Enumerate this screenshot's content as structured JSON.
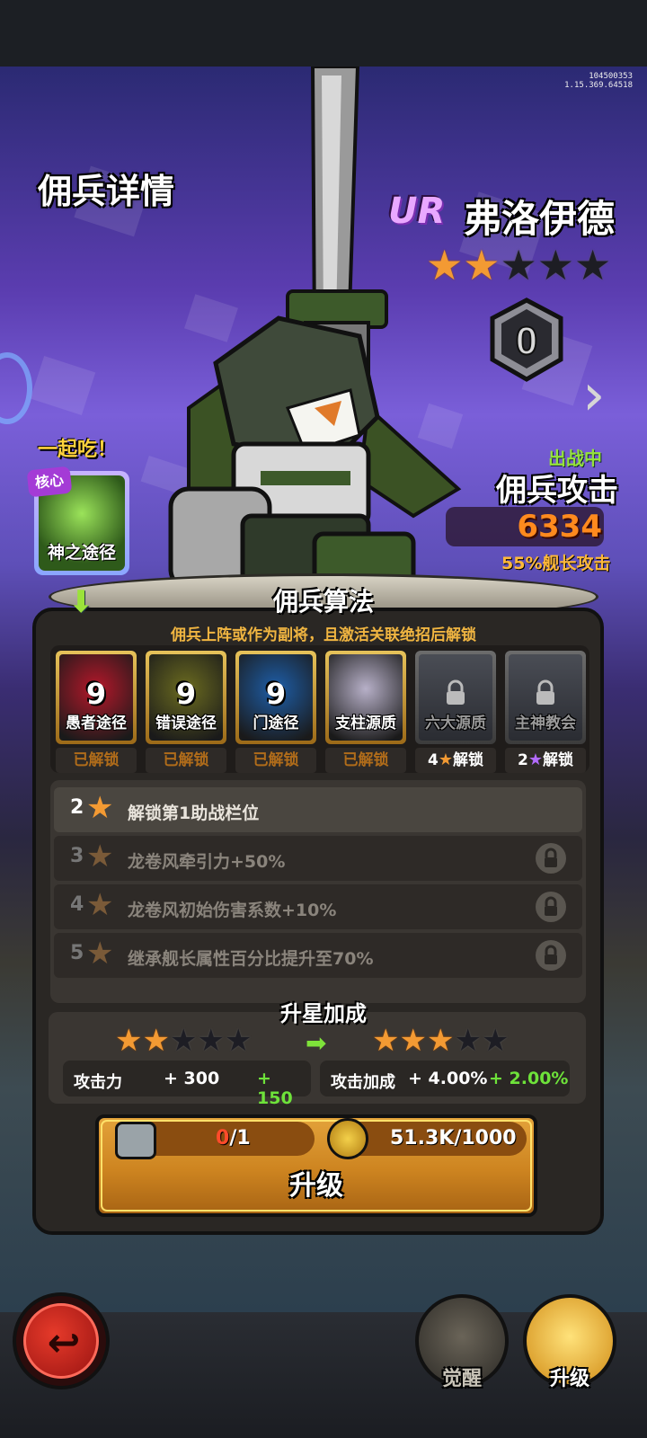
{
  "version": {
    "line1": "104500353",
    "line2": "1.15.369.64518"
  },
  "title": "佣兵详情",
  "hero": {
    "rarity": "UR",
    "name": "弗洛伊德",
    "stars_total": 5,
    "stars_filled": 2,
    "rank": "0",
    "status": "出战中",
    "attack_label": "佣兵攻击",
    "attack_value": "6334",
    "attack_sub": "55%舰长攻击"
  },
  "core": {
    "eat_label": "一起吃！",
    "tag": "核心",
    "name": "神之途径"
  },
  "algorithm": {
    "title": "佣兵算法",
    "subtitle": "佣兵上阵或作为副将，且激活关联绝招后解锁",
    "items": [
      {
        "name": "愚者途径",
        "level": "9",
        "status": "已解锁",
        "locked": false,
        "color": "#b5182a"
      },
      {
        "name": "错误途径",
        "level": "9",
        "status": "已解锁",
        "locked": false,
        "color": "#6b6b20"
      },
      {
        "name": "门途径",
        "level": "9",
        "status": "已解锁",
        "locked": false,
        "color": "#1e5ea8"
      },
      {
        "name": "支柱源质",
        "level": "",
        "status": "已解锁",
        "locked": false,
        "color": "#b7b0c8"
      },
      {
        "name": "六大源质",
        "level": "",
        "req_num": "4",
        "status": "解锁",
        "locked": true,
        "star_color": "#f39a33"
      },
      {
        "name": "主神教会",
        "level": "",
        "req_num": "2",
        "status": "解锁",
        "locked": true,
        "star_color": "#b36bff"
      }
    ]
  },
  "star_list": [
    {
      "level": "2",
      "text": "解锁第1助战栏位",
      "locked": false
    },
    {
      "level": "3",
      "text": "龙卷风牵引力+50%",
      "locked": true
    },
    {
      "level": "4",
      "text": "龙卷风初始伤害系数+10%",
      "locked": true
    },
    {
      "level": "5",
      "text": "继承舰长属性百分比提升至70%",
      "locked": true
    }
  ],
  "bonus": {
    "title": "升星加成",
    "from_stars": 2,
    "to_stars": 3,
    "left": {
      "label": "攻击力",
      "current": "+ 300",
      "add": "+ 150"
    },
    "right": {
      "label": "攻击加成",
      "current": "+ 4.00%",
      "add": "+ 2.00%"
    }
  },
  "upgrade": {
    "fragments_have": "0",
    "fragments_need": "/1",
    "coins": "51.3K/1000",
    "label": "升级"
  },
  "nav": {
    "awaken": "觉醒",
    "upgrade": "升级"
  }
}
